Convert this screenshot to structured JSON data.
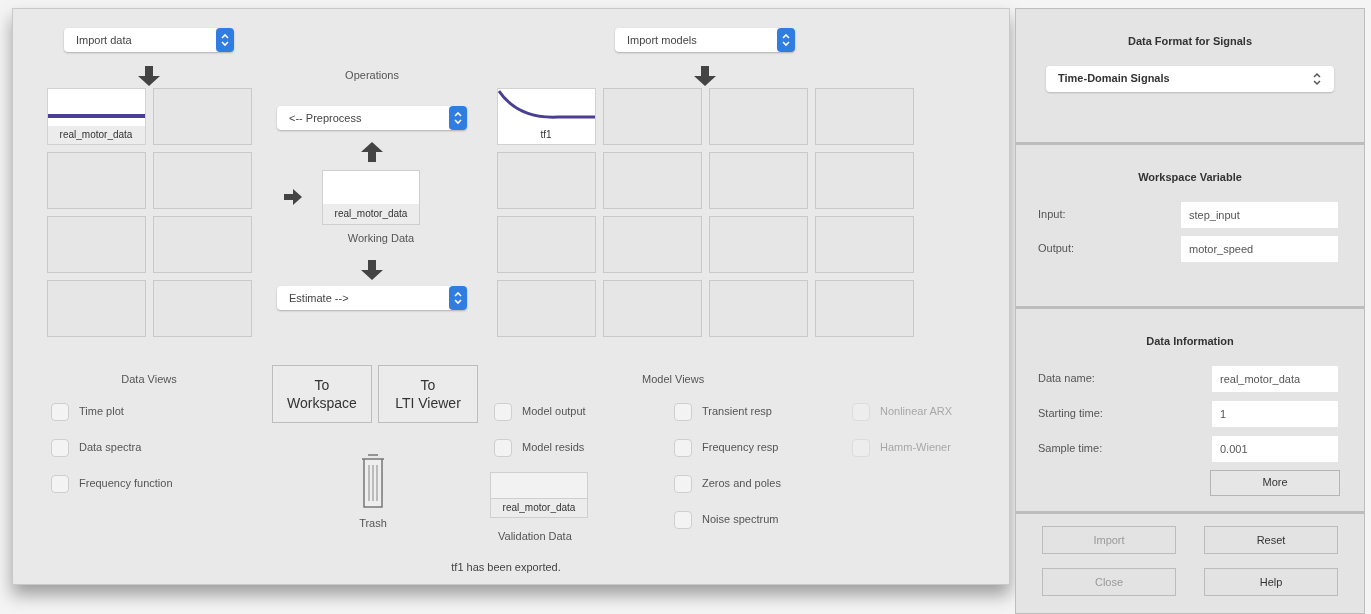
{
  "data_board": {
    "dropdown": "Import data",
    "slots": [
      {
        "kind": "signal",
        "label": "real_motor_data"
      },
      {
        "kind": "empty"
      },
      {
        "kind": "empty"
      },
      {
        "kind": "empty"
      },
      {
        "kind": "empty"
      },
      {
        "kind": "empty"
      },
      {
        "kind": "empty"
      },
      {
        "kind": "empty"
      }
    ]
  },
  "operations": {
    "title": "Operations",
    "preprocess": "<-- Preprocess",
    "working_data": "real_motor_data",
    "working_caption": "Working Data",
    "estimate": "Estimate -->"
  },
  "model_board": {
    "dropdown": "Import models",
    "slots": [
      {
        "kind": "model",
        "label": "tf1"
      },
      {
        "kind": "empty"
      },
      {
        "kind": "empty"
      },
      {
        "kind": "empty"
      },
      {
        "kind": "empty"
      },
      {
        "kind": "empty"
      },
      {
        "kind": "empty"
      },
      {
        "kind": "empty"
      },
      {
        "kind": "empty"
      },
      {
        "kind": "empty"
      },
      {
        "kind": "empty"
      },
      {
        "kind": "empty"
      },
      {
        "kind": "empty"
      },
      {
        "kind": "empty"
      },
      {
        "kind": "empty"
      },
      {
        "kind": "empty"
      }
    ]
  },
  "data_views": {
    "title": "Data Views",
    "options": [
      {
        "label": "Time plot",
        "checked": false
      },
      {
        "label": "Data spectra",
        "checked": false
      },
      {
        "label": "Frequency function",
        "checked": false
      }
    ]
  },
  "export_buttons": [
    "To\nWorkspace",
    "To\nLTI Viewer"
  ],
  "trash": "Trash",
  "validation": {
    "label": "real_motor_data",
    "caption": "Validation Data"
  },
  "model_views": {
    "title": "Model Views",
    "columns": [
      [
        {
          "label": "Model output",
          "checked": false,
          "disabled": false
        },
        {
          "label": "Model resids",
          "checked": false,
          "disabled": false
        }
      ],
      [
        {
          "label": "Transient resp",
          "checked": false,
          "disabled": false
        },
        {
          "label": "Frequency resp",
          "checked": false,
          "disabled": false
        },
        {
          "label": "Zeros and poles",
          "checked": false,
          "disabled": false
        },
        {
          "label": "Noise spectrum",
          "checked": false,
          "disabled": false
        }
      ],
      [
        {
          "label": "Nonlinear ARX",
          "checked": false,
          "disabled": true
        },
        {
          "label": "Hamm-Wiener",
          "checked": false,
          "disabled": true
        }
      ]
    ]
  },
  "status": "tf1 has been exported.",
  "data_format": {
    "title": "Data Format for Signals",
    "dropdown": "Time-Domain Signals"
  },
  "workspace_variable": {
    "title": "Workspace Variable",
    "fields": [
      {
        "label": "Input:",
        "value": "step_input"
      },
      {
        "label": "Output:",
        "value": "motor_speed"
      }
    ]
  },
  "data_information": {
    "title": "Data Information",
    "fields": [
      {
        "label": "Data name:",
        "value": "real_motor_data"
      },
      {
        "label": "Starting time:",
        "value": "1"
      },
      {
        "label": "Sample time:",
        "value": "0.001"
      }
    ],
    "more_button": "More"
  },
  "dialog_buttons": [
    {
      "label": "Import",
      "disabled": true
    },
    {
      "label": "Reset",
      "disabled": false
    },
    {
      "label": "Close",
      "disabled": true
    },
    {
      "label": "Help",
      "disabled": false
    }
  ]
}
